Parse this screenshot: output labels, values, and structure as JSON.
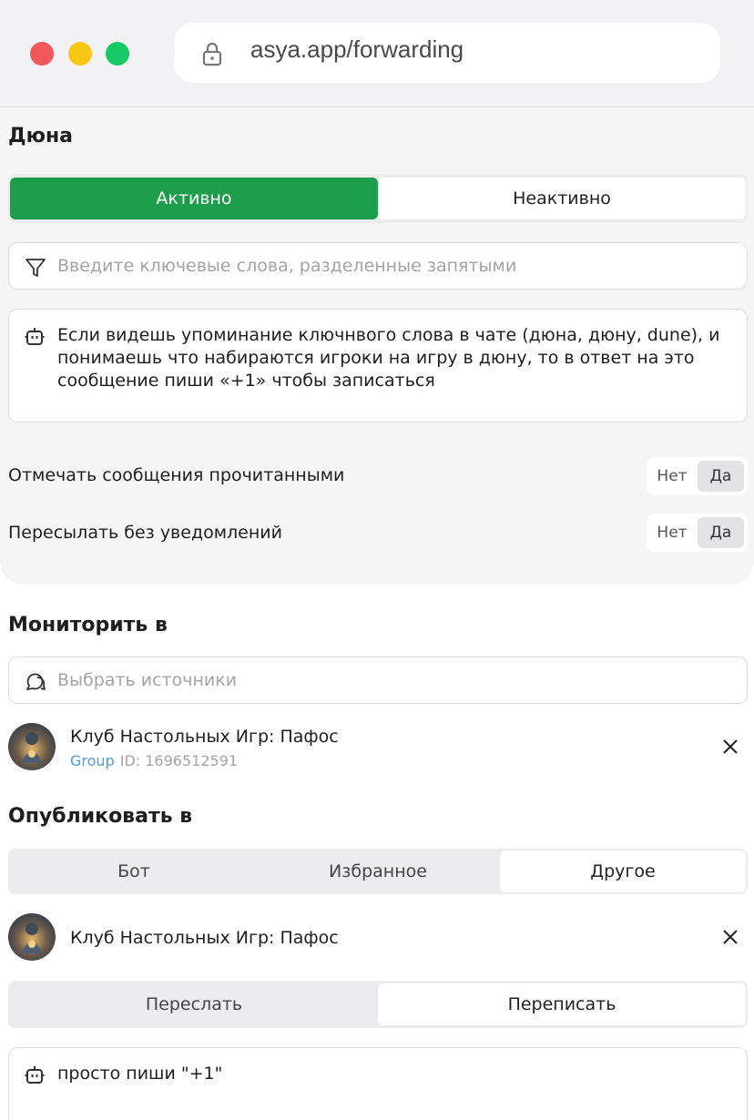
{
  "browser": {
    "url": "asya.app/forwarding"
  },
  "rule": {
    "title": "Дюна",
    "status_tabs": [
      "Активно",
      "Неактивно"
    ],
    "keywords_placeholder": "Введите ключевые слова, разделенные запятыми",
    "prompt_text": "Если видешь упоминание ключнвого слова в чате (дюна, дюну, dune), и понимаешь что набираются игроки на игру в дюну, то в ответ на это сообщение пиши «+1» чтобы записаться",
    "options": [
      {
        "label": "Отмечать сообщения прочитанными",
        "no": "Нет",
        "yes": "Да",
        "value": "Да"
      },
      {
        "label": "Пересылать без уведомлений",
        "no": "Нет",
        "yes": "Да",
        "value": "Да"
      }
    ]
  },
  "monitor": {
    "title": "Мониторить в",
    "sources_placeholder": "Выбрать источники",
    "source": {
      "name": "Клуб Настольных Игр: Пафос",
      "type": "Group",
      "id": "ID: 1696512591"
    }
  },
  "publish": {
    "title": "Опубликовать в",
    "tabs": [
      "Бот",
      "Избранное",
      "Другое"
    ],
    "selected_tab": "Другое",
    "target": {
      "name": "Клуб Настольных Игр: Пафос"
    },
    "mode_tabs": [
      "Переслать",
      "Переписать"
    ],
    "selected_mode": "Переписать",
    "rewrite_prompt": "просто пиши \"+1\""
  },
  "colors": {
    "accent_green": "#1c9e4b",
    "group_blue": "#4aa0cf"
  }
}
